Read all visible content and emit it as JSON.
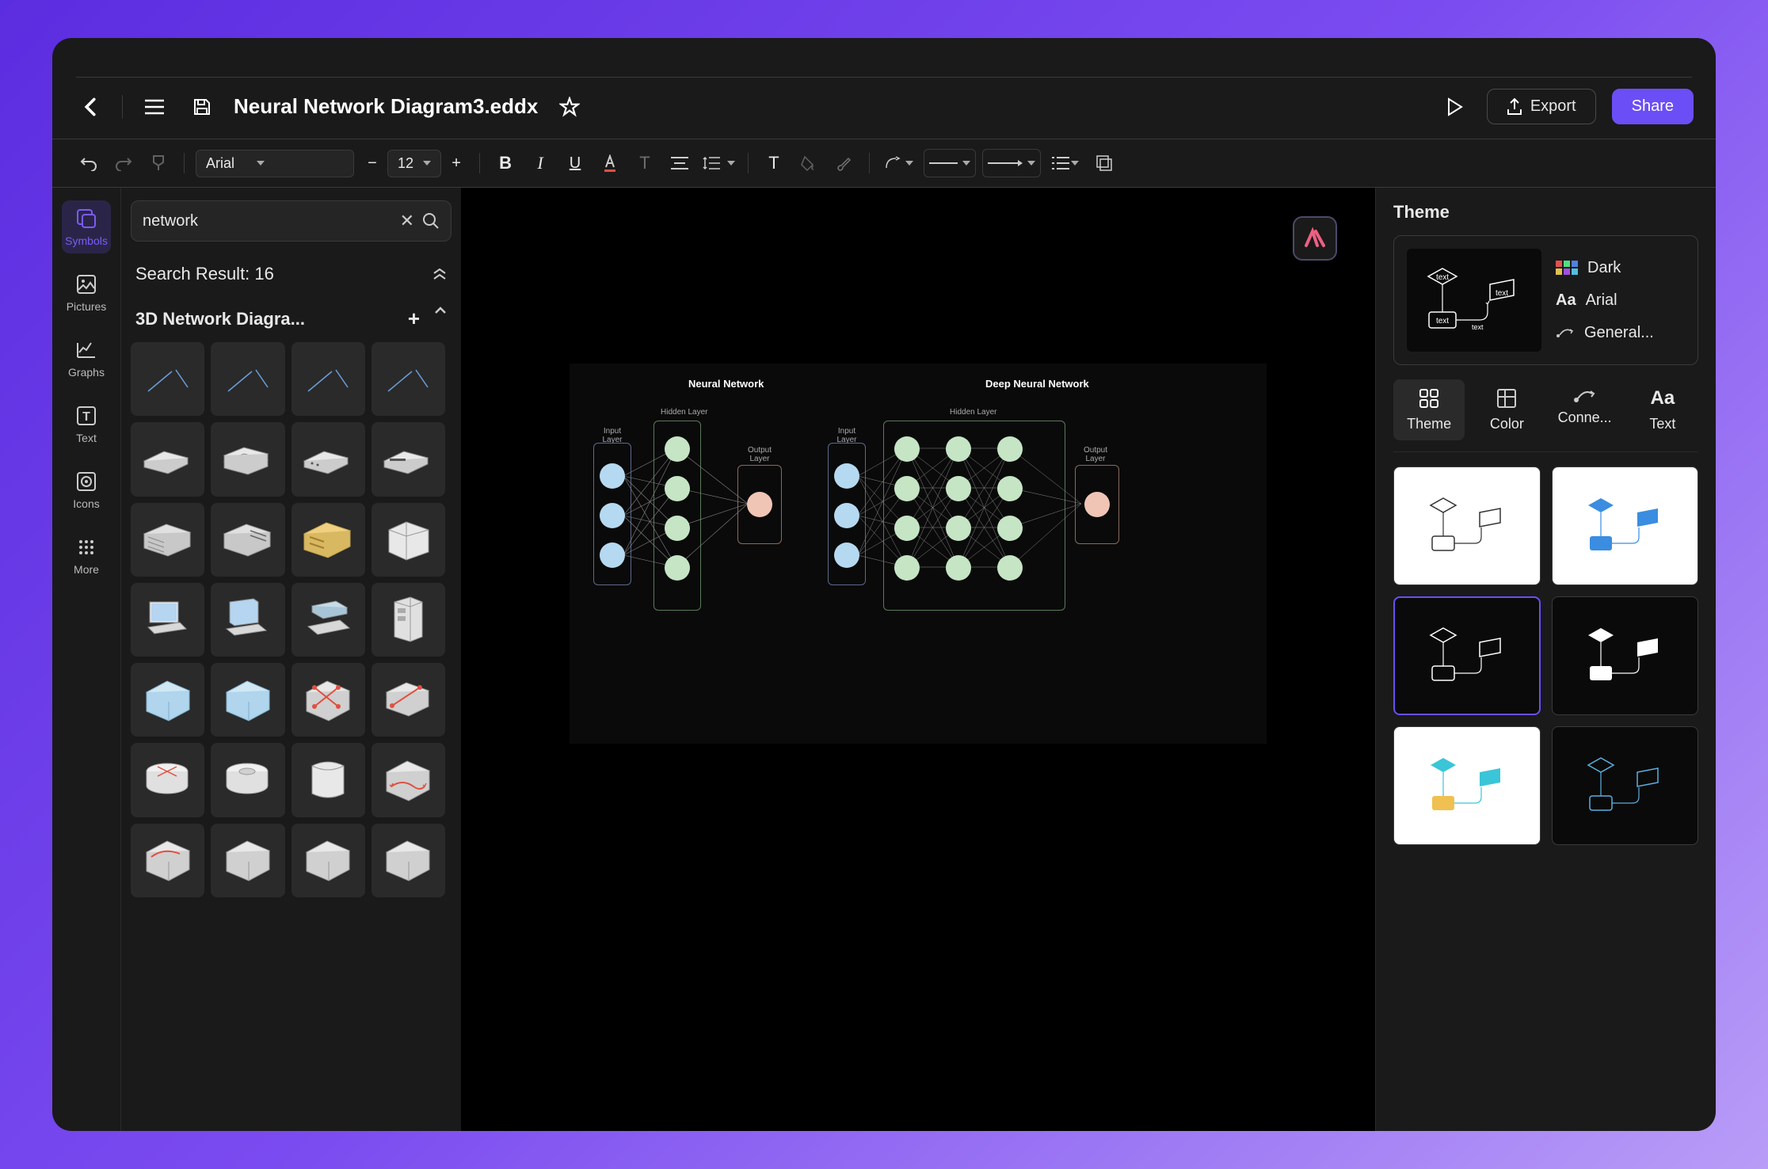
{
  "header": {
    "filename": "Neural Network Diagram3.eddx",
    "export_label": "Export",
    "share_label": "Share"
  },
  "toolbar": {
    "font": "Arial",
    "font_size": "12"
  },
  "sidebar": {
    "items": [
      {
        "label": "Symbols"
      },
      {
        "label": "Pictures"
      },
      {
        "label": "Graphs"
      },
      {
        "label": "Text"
      },
      {
        "label": "Icons"
      },
      {
        "label": "More"
      }
    ]
  },
  "symbols": {
    "search_value": "network",
    "search_result_label": "Search Result: 16",
    "category_label": "3D Network Diagra..."
  },
  "canvas": {
    "nn_title": "Neural Network",
    "dnn_title": "Deep Neural Network",
    "input_label": "Input Layer",
    "hidden_label": "Hidden Layer",
    "output_label": "Output Layer"
  },
  "theme_panel": {
    "title": "Theme",
    "current": {
      "name": "Dark",
      "font": "Arial",
      "connector": "General..."
    },
    "tabs": [
      {
        "label": "Theme"
      },
      {
        "label": "Color"
      },
      {
        "label": "Conne..."
      },
      {
        "label": "Text"
      }
    ]
  }
}
